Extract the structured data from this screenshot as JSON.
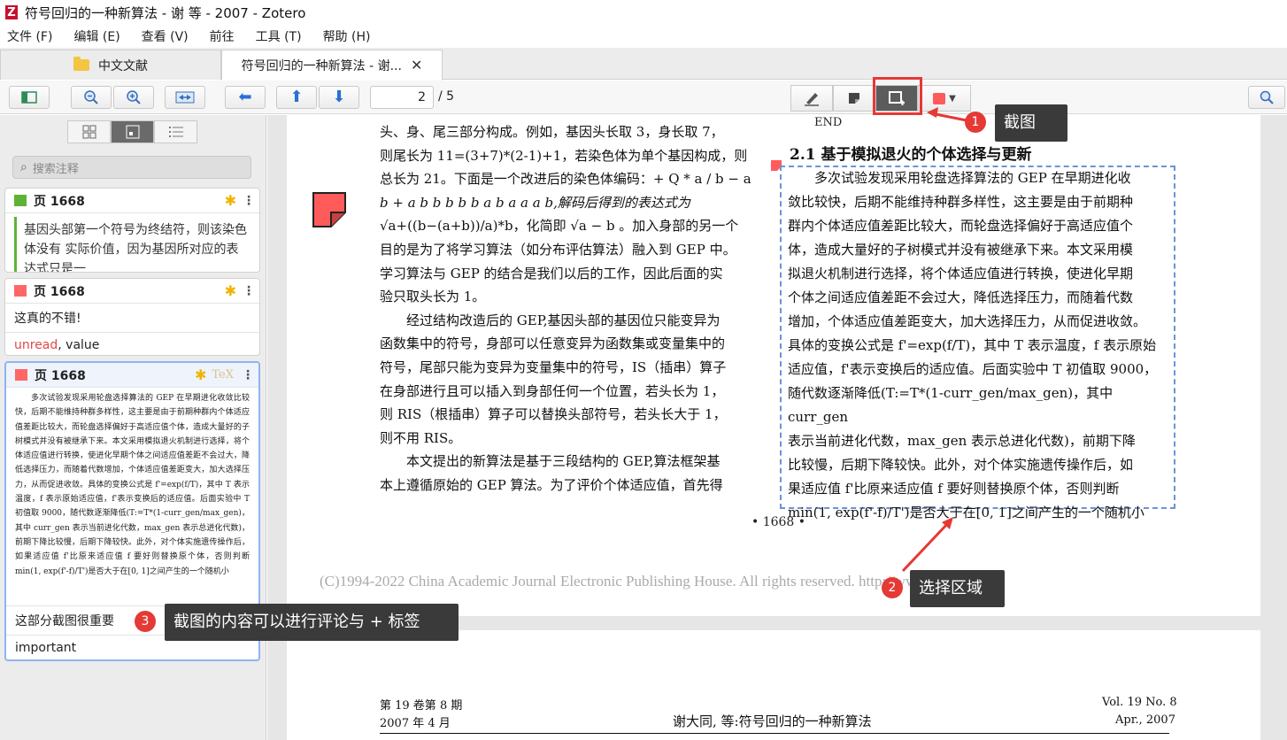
{
  "window": {
    "title": "符号回归的一种新算法 - 谢 等 - 2007 - Zotero",
    "logo": "Z"
  },
  "menu": [
    "文件 (F)",
    "编辑 (E)",
    "查看 (V)",
    "前往",
    "工具 (T)",
    "帮助 (H)"
  ],
  "tabs": {
    "library": "中文文献",
    "reader": "符号回归的一种新算法 - 谢...",
    "close": "✕"
  },
  "toolbar": {
    "page_current": "2",
    "page_total": "/ 5"
  },
  "sidebar": {
    "search_placeholder": "搜索注释",
    "annotations": [
      {
        "page": "页 1668",
        "text": "基因头部第一个符号为终结符，则该染色体没有 实际价值，因为基因所对应的表达式只是一",
        "color": "#5fb236"
      },
      {
        "page": "页 1668",
        "comment": "这真的不错!",
        "tag_unread": "unread",
        "tag_sep": ", value",
        "color": "#ff6666"
      },
      {
        "page": "页 1668",
        "tex": "TeX",
        "comment": "这部分截图很重要",
        "tags": "important",
        "color": "#ff6666",
        "thumb": "多次试验发现采用轮盘选择算法的 GEP 在早期进化收敛比较快，后期不能维持种群多样性，这主要是由于前期种群内个体适应值差距比较大，而轮盘选择偏好于高适应值个体，造成大量好的子树模式并没有被继承下来。本文采用模拟退火机制进行选择，将个体适应值进行转换，使进化早期个体之间适应值差距不会过大，降低选择压力，而随着代数增加，个体适应值差距变大，加大选择压力，从而促进收敛。具体的变换公式是 f'=exp(f/T)，其中 T 表示温度，f 表示原始适应值，f'表示变换后的适应值。后面实验中 T 初值取 9000，随代数逐渐降低(T:=T*(1-curr_gen/max_gen)，其中 curr_gen 表示当前进化代数，max_gen 表示总进化代数)，前期下降比较慢，后期下降较快。此外，对个体实施遗传操作后，如果适应值 f'比原来适应值 f 要好则替换原个体，否则判断 min(1, exp(f'-f)/T')是否大于在[0, 1]之间产生的一个随机小"
      }
    ]
  },
  "document": {
    "end_label": "END",
    "left_lines": [
      "头、身、尾三部分构成。例如，基因头长取 3，身长取 7，",
      "则尾长为 11=(3+7)*(2-1)+1，若染色体为单个基因构成，则",
      "总长为 21。下面是一个改进后的染色体编码：+ Q * a / b − a",
      "b + a b b b b b a b a a a b,解码后得到的表达式为",
      "√a+((b−(a+b))/a)*b，化简即 √a − b 。加入身部的另一个",
      "目的是为了将学习算法（如分布评估算法）融入到 GEP 中。",
      "学习算法与 GEP 的结合是我们以后的工作，因此后面的实",
      "验只取头长为 1。",
      "经过结构改造后的 GEP,基因头部的基因位只能变异为",
      "函数集中的符号，身部可以任意变异为函数集或变量集中的",
      "符号，尾部只能为变异为变量集中的符号，IS（插串）算子",
      "在身部进行且可以插入到身部任何一个位置，若头长为 1，",
      "则 RIS（根插串）算子可以替换头部符号，若头长大于 1，",
      "则不用 RIS。",
      "本文提出的新算法是基于三段结构的 GEP,算法框架基",
      "本上遵循原始的 GEP 算法。为了评价个体适应值，首先得"
    ],
    "section_title": "2.1 基于模拟退火的个体选择与更新",
    "right_lines": [
      "多次试验发现采用轮盘选择算法的 GEP 在早期进化收",
      "敛比较快，后期不能维持种群多样性，这主要是由于前期种",
      "群内个体适应值差距比较大，而轮盘选择偏好于高适应值个",
      "体，造成大量好的子树模式并没有被继承下来。本文采用模",
      "拟退火机制进行选择，将个体适应值进行转换，使进化早期",
      "个体之间适应值差距不会过大，降低选择压力，而随着代数",
      "增加，个体适应值差距变大，加大选择压力，从而促进收敛。",
      "具体的变换公式是 f'=exp(f/T)，其中 T 表示温度，f 表示原始",
      "适应值，f'表示变换后的适应值。后面实验中 T 初值取 9000，",
      "随代数逐渐降低(T:=T*(1-curr_gen/max_gen)，其中 curr_gen",
      "表示当前进化代数，max_gen 表示总进化代数)，前期下降",
      "比较慢，后期下降较快。此外，对个体实施遗传操作后，如",
      "果适应值 f'比原来适应值 f 要好则替换原个体，否则判断",
      "min(1, exp(f'-f)/T')是否大于在[0, 1]之间产生的一个随机小"
    ],
    "page_number": "• 1668 •",
    "copyright": "(C)1994-2022 China Academic Journal Electronic Publishing House. All rights reserved.    http://www.cnki.net",
    "next_page": {
      "vol_cn": "第 19 卷第 8 期",
      "date_cn": "2007 年 4 月",
      "title": "谢大同, 等:符号回归的一种新算法",
      "vol_en": "Vol. 19 No. 8",
      "date_en": "Apr., 2007"
    }
  },
  "callouts": [
    {
      "num": "1",
      "text": "截图"
    },
    {
      "num": "2",
      "text": "选择区域"
    },
    {
      "num": "3",
      "text": "截图的内容可以进行评论与 + 标签"
    }
  ]
}
